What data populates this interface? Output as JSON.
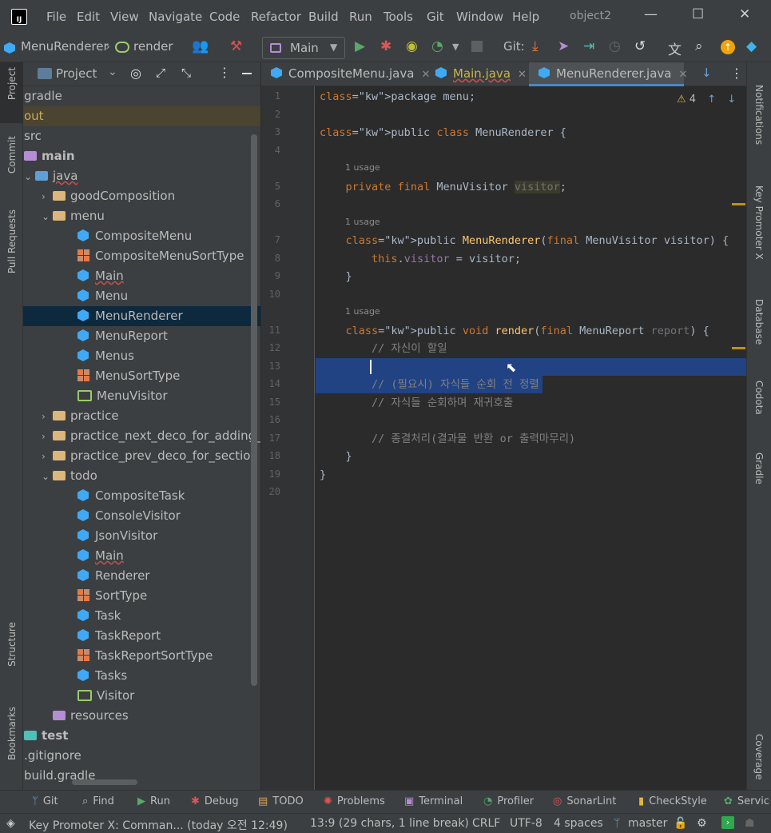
{
  "window": {
    "title": "object2",
    "menu": [
      "File",
      "Edit",
      "View",
      "Navigate",
      "Code",
      "Refactor",
      "Build",
      "Run",
      "Tools",
      "Git",
      "Window",
      "Help"
    ],
    "controls": [
      "—",
      "☐",
      "✕"
    ]
  },
  "toolbar": {
    "breadcrumb": [
      "MenuRenderer",
      "render"
    ],
    "run_config": "Main",
    "git_label": "Git:"
  },
  "left_strip": [
    "Project",
    "Commit",
    "Pull Requests",
    "Structure",
    "Bookmarks"
  ],
  "right_strip": [
    "Notifications",
    "Key Promoter X",
    "Database",
    "Codota",
    "Gradle",
    "Coverage"
  ],
  "project_panel": {
    "title": "Project",
    "tree": [
      {
        "label": "gradle",
        "kind": "text",
        "indent": 0
      },
      {
        "label": "out",
        "kind": "out",
        "indent": 0
      },
      {
        "label": "src",
        "kind": "text",
        "indent": 0
      },
      {
        "label": "main",
        "kind": "folder-purple",
        "indent": 0,
        "bold": true
      },
      {
        "label": "java",
        "kind": "folder-blue",
        "indent": 1,
        "arrow": "v"
      },
      {
        "label": "goodComposition",
        "kind": "folder",
        "indent": 2,
        "arrow": ">"
      },
      {
        "label": "menu",
        "kind": "folder",
        "indent": 2,
        "arrow": "v"
      },
      {
        "label": "CompositeMenu",
        "kind": "class",
        "indent": 3
      },
      {
        "label": "CompositeMenuSortType",
        "kind": "enum",
        "indent": 3
      },
      {
        "label": "Main",
        "kind": "main",
        "indent": 3
      },
      {
        "label": "Menu",
        "kind": "class",
        "indent": 3
      },
      {
        "label": "MenuRenderer",
        "kind": "class",
        "indent": 3,
        "selected": true
      },
      {
        "label": "MenuReport",
        "kind": "class",
        "indent": 3
      },
      {
        "label": "Menus",
        "kind": "class",
        "indent": 3
      },
      {
        "label": "MenuSortType",
        "kind": "enum",
        "indent": 3
      },
      {
        "label": "MenuVisitor",
        "kind": "iface",
        "indent": 3
      },
      {
        "label": "practice",
        "kind": "folder",
        "indent": 2,
        "arrow": ">"
      },
      {
        "label": "practice_next_deco_for_adding_cu",
        "kind": "folder",
        "indent": 2,
        "arrow": ">"
      },
      {
        "label": "practice_prev_deco_for_section",
        "kind": "folder",
        "indent": 2,
        "arrow": ">"
      },
      {
        "label": "todo",
        "kind": "folder",
        "indent": 2,
        "arrow": "v"
      },
      {
        "label": "CompositeTask",
        "kind": "class",
        "indent": 3
      },
      {
        "label": "ConsoleVisitor",
        "kind": "class",
        "indent": 3
      },
      {
        "label": "JsonVisitor",
        "kind": "class",
        "indent": 3
      },
      {
        "label": "Main",
        "kind": "main",
        "indent": 3
      },
      {
        "label": "Renderer",
        "kind": "class",
        "indent": 3
      },
      {
        "label": "SortType",
        "kind": "enum",
        "indent": 3
      },
      {
        "label": "Task",
        "kind": "class",
        "indent": 3
      },
      {
        "label": "TaskReport",
        "kind": "class",
        "indent": 3
      },
      {
        "label": "TaskReportSortType",
        "kind": "enum",
        "indent": 3
      },
      {
        "label": "Tasks",
        "kind": "class",
        "indent": 3
      },
      {
        "label": "Visitor",
        "kind": "iface",
        "indent": 3
      },
      {
        "label": "resources",
        "kind": "folder-purple",
        "indent": 1
      },
      {
        "label": "test",
        "kind": "folder-teal",
        "indent": 0,
        "bold": true
      },
      {
        "label": ".gitignore",
        "kind": "text",
        "indent": 0
      },
      {
        "label": "build.gradle",
        "kind": "text",
        "indent": 0
      }
    ]
  },
  "editor": {
    "tabs": [
      {
        "label": "CompositeMenu.java",
        "active": false
      },
      {
        "label": "Main.java",
        "active": false
      },
      {
        "label": "MenuRenderer.java",
        "active": true
      }
    ],
    "warnings": "4",
    "usage_hint": "1 usage",
    "lines": [
      {
        "n": "1",
        "text": "package menu;"
      },
      {
        "n": "2",
        "text": ""
      },
      {
        "n": "3",
        "text": "public class MenuRenderer {"
      },
      {
        "n": "4",
        "text": ""
      },
      {
        "n": "5",
        "text": "    private final MenuVisitor visitor;",
        "usage": true
      },
      {
        "n": "6",
        "text": ""
      },
      {
        "n": "7",
        "text": "    public MenuRenderer(final MenuVisitor visitor) {",
        "usage": true
      },
      {
        "n": "8",
        "text": "        this.visitor = visitor;"
      },
      {
        "n": "9",
        "text": "    }"
      },
      {
        "n": "10",
        "text": ""
      },
      {
        "n": "11",
        "text": "    public void render(final MenuReport report) {",
        "usage": true
      },
      {
        "n": "12",
        "text": "        // 자신이 할일"
      },
      {
        "n": "13",
        "text": ""
      },
      {
        "n": "14",
        "text": "        // (필요시) 자식들 순회 전 정렬"
      },
      {
        "n": "15",
        "text": "        // 자식들 순회하며 재귀호출"
      },
      {
        "n": "16",
        "text": ""
      },
      {
        "n": "17",
        "text": "        // 종결처리(결과물 반환 or 출력마무리)"
      },
      {
        "n": "18",
        "text": "    }"
      },
      {
        "n": "19",
        "text": "}"
      },
      {
        "n": "20",
        "text": ""
      }
    ]
  },
  "bottom_tools": [
    "Git",
    "Find",
    "Run",
    "Debug",
    "TODO",
    "Problems",
    "Terminal",
    "Profiler",
    "SonarLint",
    "CheckStyle",
    "Servic"
  ],
  "status": {
    "message": "Key Promoter X: Comman... (today 오전 12:49)",
    "position": "13:9 (29 chars, 1 line break)",
    "line_sep": "CRLF",
    "encoding": "UTF-8",
    "indent": "4 spaces",
    "branch": "master"
  }
}
